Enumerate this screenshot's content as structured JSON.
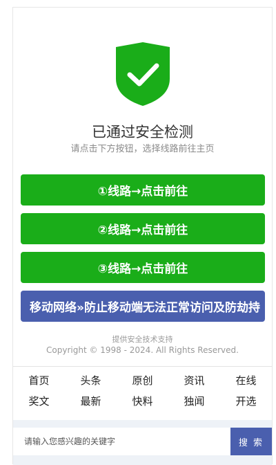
{
  "header": {
    "title": "已通过安全检测",
    "subtitle": "请点击下方按钮，选择线路前往主页"
  },
  "buttons": [
    {
      "label": "①线路→点击前往"
    },
    {
      "label": "②线路→点击前往"
    },
    {
      "label": "③线路→点击前往"
    },
    {
      "label": "移动网络»防止移动端无法正常访问及防劫持"
    }
  ],
  "footer": {
    "support": "提供安全技术支持",
    "copyright": "Copyright © 1998 - 2024. All Rights Reserved."
  },
  "nav": [
    {
      "label": "首页"
    },
    {
      "label": "头条"
    },
    {
      "label": "原创"
    },
    {
      "label": "资讯"
    },
    {
      "label": "在线"
    },
    {
      "label": "奖文"
    },
    {
      "label": "最新"
    },
    {
      "label": "快料"
    },
    {
      "label": "独闻"
    },
    {
      "label": "开选"
    }
  ],
  "search": {
    "placeholder": "请输入您感兴趣的关键字",
    "button_label": "搜 索"
  },
  "colors": {
    "shield": "#1aad19",
    "primary_button": "#1aad19",
    "mobile_button": "#4a5fae"
  },
  "icons": {
    "shield": "shield-check-icon"
  }
}
